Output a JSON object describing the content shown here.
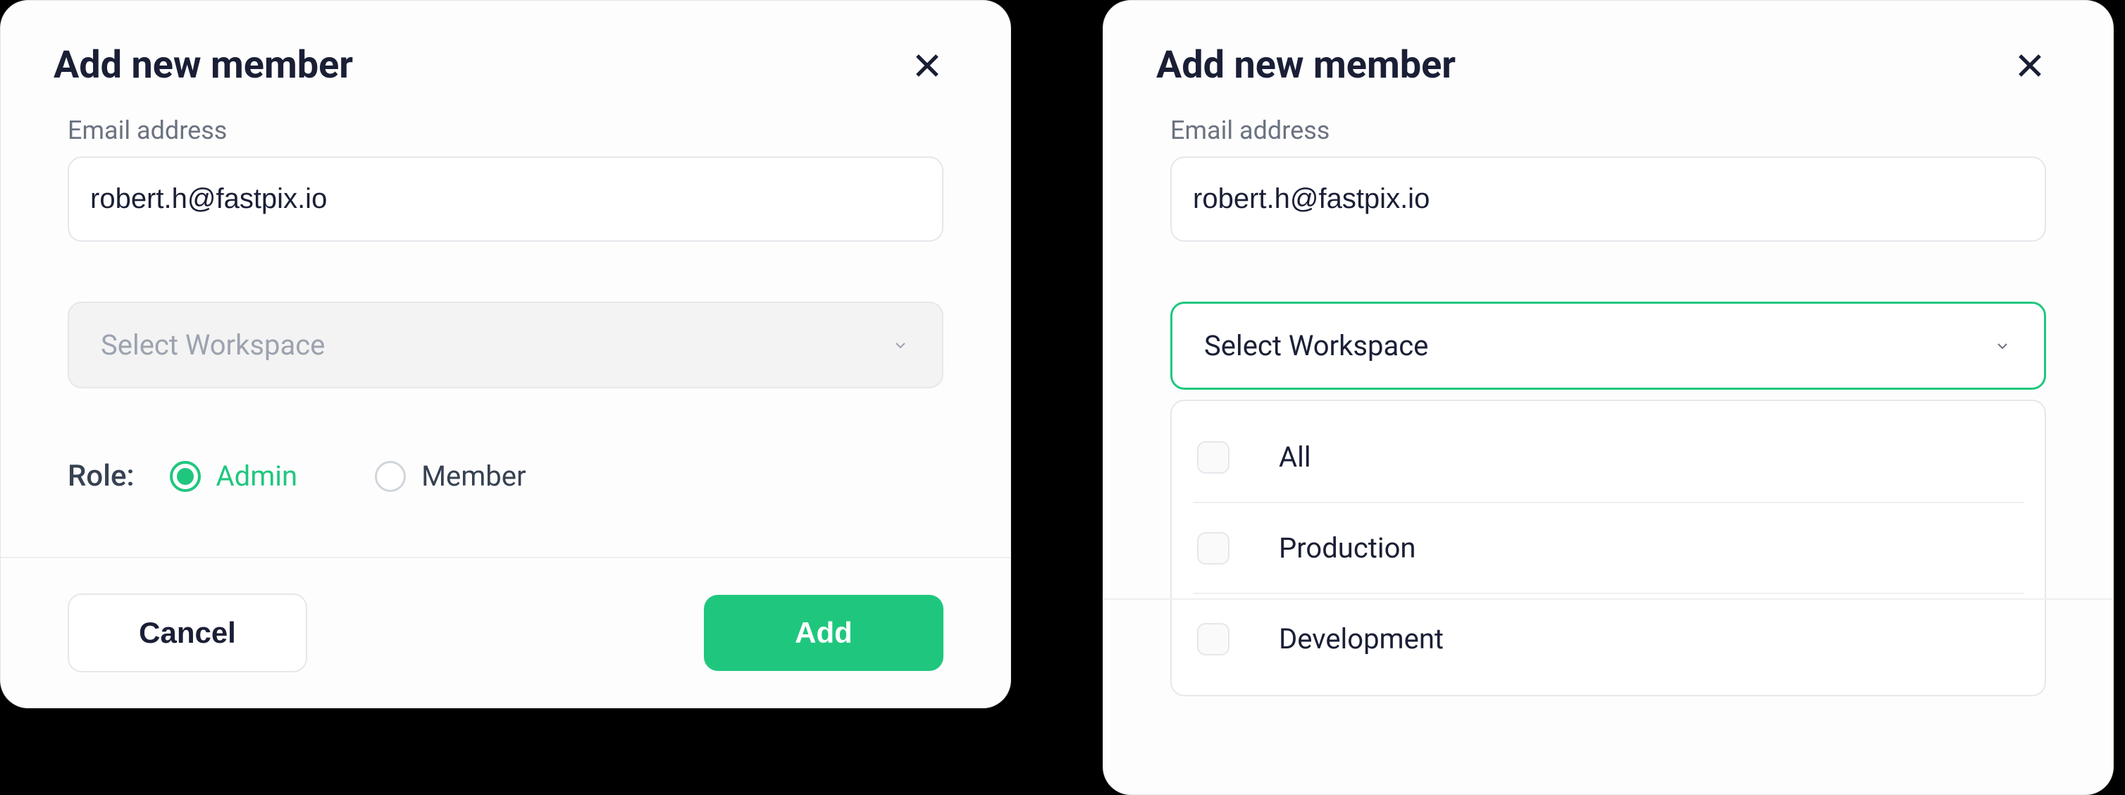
{
  "dialog_left": {
    "title": "Add new member",
    "email_label": "Email address",
    "email_value": "robert.h@fastpix.io",
    "workspace_placeholder": "Select Workspace",
    "role_label": "Role:",
    "role_options": {
      "admin": "Admin",
      "member": "Member"
    },
    "selected_role": "admin",
    "buttons": {
      "cancel": "Cancel",
      "add": "Add"
    }
  },
  "dialog_right": {
    "title": "Add new member",
    "email_label": "Email address",
    "email_value": "robert.h@fastpix.io",
    "workspace_placeholder": "Select Workspace",
    "workspace_options": {
      "all": "All",
      "production": "Production",
      "development": "Development"
    }
  }
}
